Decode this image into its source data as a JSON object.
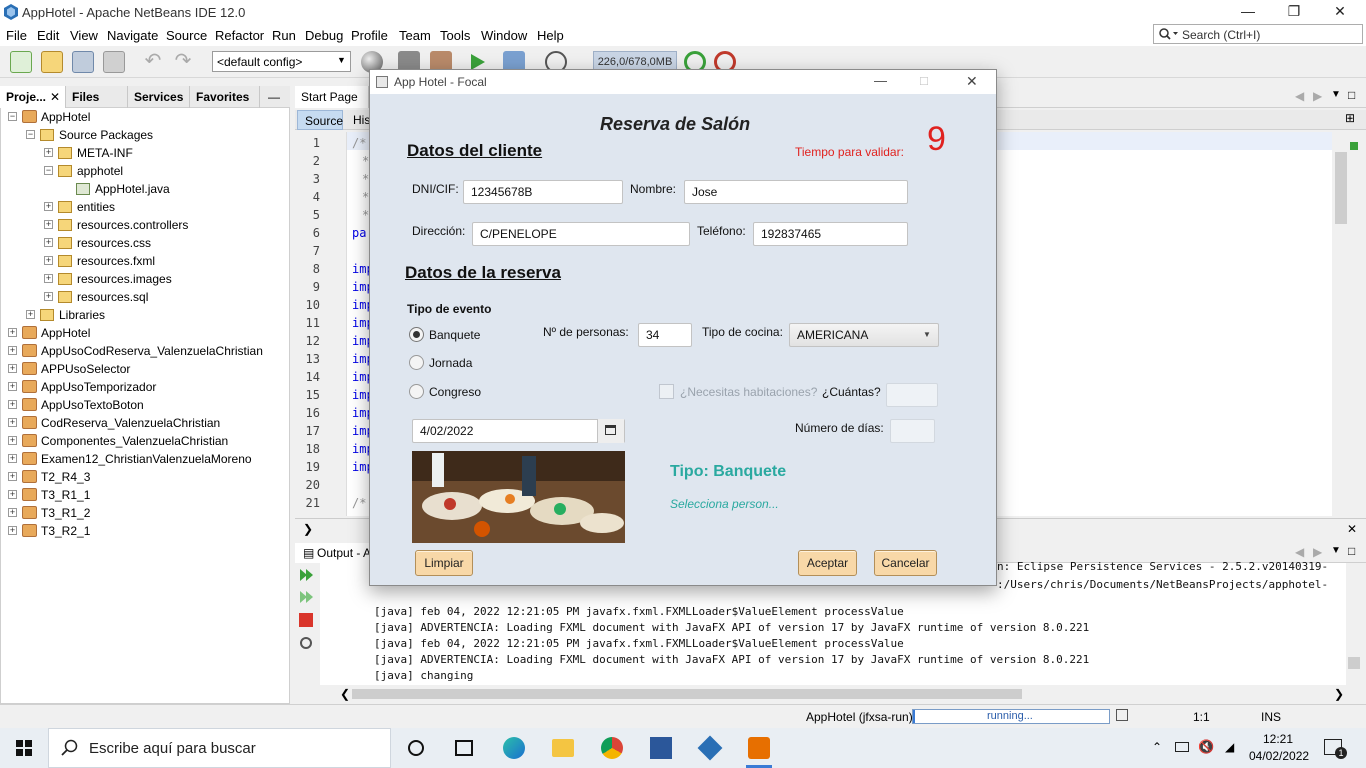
{
  "window": {
    "title": "AppHotel - Apache NetBeans IDE 12.0"
  },
  "menu": [
    "File",
    "Edit",
    "View",
    "Navigate",
    "Source",
    "Refactor",
    "Run",
    "Debug",
    "Profile",
    "Team",
    "Tools",
    "Window",
    "Help"
  ],
  "search": {
    "placeholder": "Search (Ctrl+I)"
  },
  "toolbar": {
    "config": "<default config>",
    "memory": "226,0/678,0MB"
  },
  "left_tabs": [
    "Proje...",
    "Files",
    "Services",
    "Favorites"
  ],
  "tree": [
    {
      "label": "AppHotel",
      "depth": 0,
      "kind": "project"
    },
    {
      "label": "Source Packages",
      "depth": 1,
      "kind": "folder"
    },
    {
      "label": "META-INF",
      "depth": 2,
      "kind": "package"
    },
    {
      "label": "apphotel",
      "depth": 2,
      "kind": "package"
    },
    {
      "label": "AppHotel.java",
      "depth": 3,
      "kind": "file"
    },
    {
      "label": "entities",
      "depth": 2,
      "kind": "package"
    },
    {
      "label": "resources.controllers",
      "depth": 2,
      "kind": "package"
    },
    {
      "label": "resources.css",
      "depth": 2,
      "kind": "package"
    },
    {
      "label": "resources.fxml",
      "depth": 2,
      "kind": "package"
    },
    {
      "label": "resources.images",
      "depth": 2,
      "kind": "package"
    },
    {
      "label": "resources.sql",
      "depth": 2,
      "kind": "package"
    },
    {
      "label": "Libraries",
      "depth": 1,
      "kind": "folder"
    },
    {
      "label": "AppHotel",
      "depth": 0,
      "kind": "project"
    },
    {
      "label": "AppUsoCodReserva_ValenzuelaChristian",
      "depth": 0,
      "kind": "project"
    },
    {
      "label": "APPUsoSelector",
      "depth": 0,
      "kind": "project"
    },
    {
      "label": "AppUsoTemporizador",
      "depth": 0,
      "kind": "project"
    },
    {
      "label": "AppUsoTextoBoton",
      "depth": 0,
      "kind": "project"
    },
    {
      "label": "CodReserva_ValenzuelaChristian",
      "depth": 0,
      "kind": "project"
    },
    {
      "label": "Componentes_ValenzuelaChristian",
      "depth": 0,
      "kind": "project"
    },
    {
      "label": "Examen12_ChristianValenzuelaMoreno",
      "depth": 0,
      "kind": "project"
    },
    {
      "label": "T2_R4_3",
      "depth": 0,
      "kind": "project"
    },
    {
      "label": "T3_R1_1",
      "depth": 0,
      "kind": "project"
    },
    {
      "label": "T3_R1_2",
      "depth": 0,
      "kind": "project"
    },
    {
      "label": "T3_R2_1",
      "depth": 0,
      "kind": "project"
    }
  ],
  "editor": {
    "tab": "Start Page",
    "subtabs": [
      "Source",
      "His"
    ],
    "line_numbers": [
      "1",
      "2",
      "3",
      "4",
      "5",
      "6",
      "7",
      "8",
      "9",
      "10",
      "11",
      "12",
      "13",
      "14",
      "15",
      "16",
      "17",
      "18",
      "19",
      "20",
      "21"
    ],
    "code": [
      "/*",
      "*",
      "*",
      "*",
      "*",
      "pa",
      "",
      "imp",
      "imp",
      "imp",
      "imp",
      "imp",
      "imp",
      "imp",
      "imp",
      "imp",
      "imp",
      "imp",
      "imp",
      "",
      "/*"
    ]
  },
  "output": {
    "tab": "Output - A",
    "lines": [
      "[java] feb 04, 2022 12:21:05 PM javafx.fxml.FXMLLoader$ValueElement processValue",
      "[java] ADVERTENCIA: Loading FXML document with JavaFX API of version 17 by JavaFX runtime of version 8.0.221",
      "[java] feb 04, 2022 12:21:05 PM javafx.fxml.FXMLLoader$ValueElement processValue",
      "[java] ADVERTENCIA: Loading FXML document with JavaFX API of version 17 by JavaFX runtime of version 8.0.221",
      "[java] changing"
    ],
    "right_fragments": [
      "n: Eclipse Persistence Services - 2.5.2.v20140319-",
      ":/Users/chris/Documents/NetBeansProjects/apphotel-"
    ]
  },
  "status": {
    "task": "AppHotel (jfxsa-run)",
    "progress_text": "running...",
    "position": "1:1",
    "mode": "INS"
  },
  "taskbar": {
    "search_placeholder": "Escribe aquí para buscar",
    "time": "12:21",
    "date": "04/02/2022",
    "notif_count": "1"
  },
  "dialog": {
    "title": "App Hotel - Focal",
    "heading": "Reserva de Salón",
    "timer_label": "Tiempo para validar:",
    "timer_value": "9",
    "client_section": "Datos del cliente",
    "dni_label": "DNI/CIF:",
    "dni_value": "12345678B",
    "nombre_label": "Nombre:",
    "nombre_value": "Jose",
    "direccion_label": "Dirección:",
    "direccion_value": "C/PENELOPE",
    "telefono_label": "Teléfono:",
    "telefono_value": "192837465",
    "reserva_section": "Datos de la reserva",
    "evento_label": "Tipo de evento",
    "radios": [
      "Banquete",
      "Jornada",
      "Congreso"
    ],
    "selected_radio": "Banquete",
    "personas_label": "Nº de personas:",
    "personas_value": "34",
    "cocina_label": "Tipo de cocina:",
    "cocina_value": "AMERICANA",
    "habitaciones_label": "¿Necesitas habitaciones?",
    "cuantas_label": "¿Cuántas?",
    "fecha_value": "4/02/2022",
    "dias_label": "Número de días:",
    "tipo_label": "Tipo: Banquete",
    "selecciona_text": "Selecciona person...",
    "limpiar": "Limpiar",
    "aceptar": "Aceptar",
    "cancelar": "Cancelar"
  }
}
